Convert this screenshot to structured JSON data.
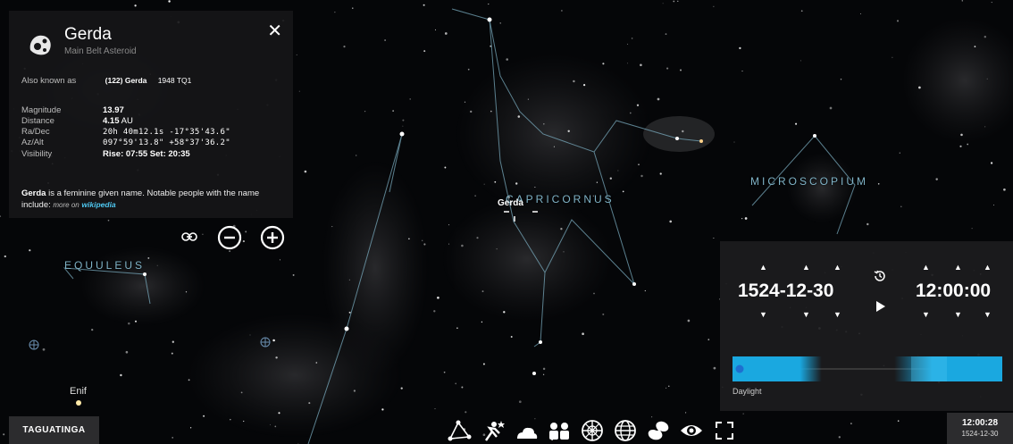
{
  "object": {
    "name": "Gerda",
    "type": "Main Belt Asteroid",
    "aka_label": "Also known as",
    "aka_values": [
      "(122) Gerda",
      "1948 TQ1"
    ],
    "fields": [
      {
        "label": "Magnitude",
        "value": "13.97",
        "unit": ""
      },
      {
        "label": "Distance",
        "value": "4.15",
        "unit": " AU"
      },
      {
        "label": "Ra/Dec",
        "value": "20h 40m12.1s  -17°35'43.6\"",
        "unit": "",
        "mono": true
      },
      {
        "label": "Az/Alt",
        "value": "097°59'13.8\"  +58°37'36.2\"",
        "unit": "",
        "mono": true
      },
      {
        "label": "Visibility",
        "value": "Rise: 07:55   Set: 20:35",
        "unit": ""
      }
    ],
    "description_bold": "Gerda",
    "description_rest": " is a feminine given name. Notable people with the name include:",
    "more_on": "more on",
    "wikipedia": "wikipedia"
  },
  "sky_labels": {
    "constellations": [
      "EQUULEUS",
      "CAPRICORNUS",
      "MICROSCOPIUM"
    ],
    "star": "Enif",
    "selected": "Gerda"
  },
  "location": "TAGUATINGA",
  "time_panel": {
    "date": "1524-12-30",
    "time": "12:00:00",
    "daylight_label": "Daylight"
  },
  "clock": {
    "time": "12:00:28",
    "date": "1524-12-30"
  },
  "icons": {
    "close": "close-icon",
    "link": "link-icon",
    "zoom_out": "zoom-out-icon",
    "zoom_in": "zoom-in-icon",
    "reset_time": "history-icon",
    "play": "play-icon",
    "toolbar": [
      "constellation-lines-icon",
      "constellation-art-icon",
      "atmosphere-icon",
      "landscape-icon",
      "azimuthal-grid-icon",
      "equatorial-grid-icon",
      "dso-icon",
      "eye-icon",
      "fullscreen-icon"
    ]
  },
  "colors": {
    "accent": "#4ec7f0",
    "constellation_line": "#7fb3c7",
    "panel_bg": "#161618"
  }
}
